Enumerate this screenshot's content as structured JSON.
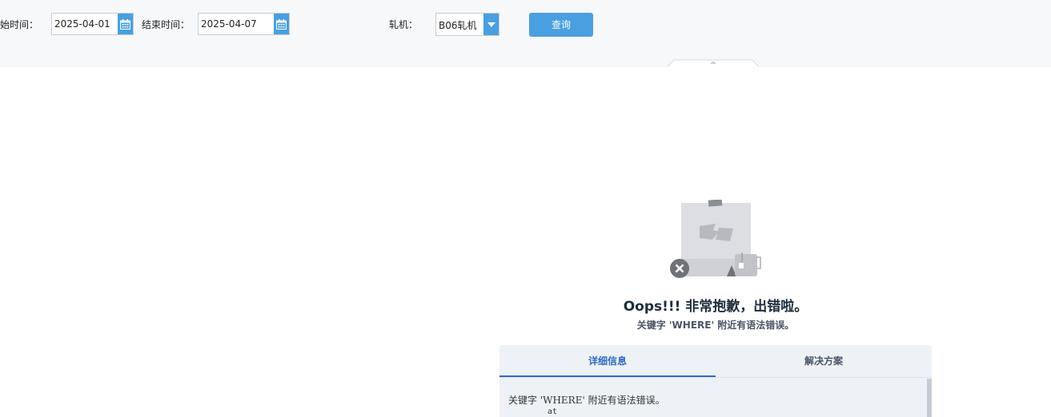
{
  "toolbar": {
    "start_label": "开始时间：",
    "start_value": "2025-04-01",
    "end_label": "结束时间：",
    "end_value": "2025-04-07",
    "mill_label": "轧机：",
    "mill_value": "B06轧机",
    "query_label": "查询"
  },
  "error": {
    "title": "Oops!!! 非常抱歉，出错啦。",
    "subtitle": "关键字 'WHERE' 附近有语法错误。",
    "tabs": [
      "详细信息",
      "解决方案"
    ],
    "active_tab": 0,
    "detail": "关键字 'WHERE' 附近有语法错误。",
    "detail_at": "at"
  },
  "colors": {
    "accent": "#4a9fe0",
    "tab_active": "#2e6bc6",
    "toolbar_bg": "#f7f8fa",
    "panel_bg": "#eef1f6"
  }
}
